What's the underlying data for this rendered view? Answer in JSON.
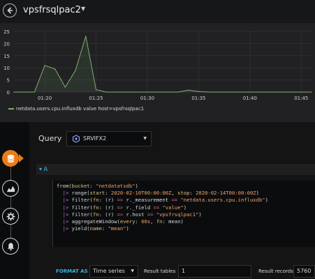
{
  "header": {
    "title": "vpsfrsqlpac2"
  },
  "graph": {
    "legend": "netdata.users.cpu.influxdb value host=vpsfrsqlpac1",
    "line_color": "#7eb26d"
  },
  "chart_data": {
    "type": "area",
    "title": "",
    "xlabel": "",
    "ylabel": "",
    "ylim": [
      0,
      25
    ],
    "y_ticks": [
      "0",
      "5",
      "10",
      "15",
      "20",
      "25"
    ],
    "x_ticks": [
      "01:20",
      "01:25",
      "01:30",
      "01:35",
      "01:40",
      "01:45"
    ],
    "series": [
      {
        "name": "netdata.users.cpu.influxdb value host=vpsfrsqlpac1",
        "x": [
          "01:17",
          "01:19",
          "01:20",
          "01:21",
          "01:22",
          "01:23",
          "01:24",
          "01:25",
          "01:26",
          "01:27",
          "01:28",
          "01:29",
          "01:30",
          "01:31",
          "01:32",
          "01:33",
          "01:34",
          "01:35",
          "01:36",
          "01:37",
          "01:38",
          "01:39",
          "01:40",
          "01:41",
          "01:42",
          "01:43",
          "01:44",
          "01:45",
          "01:46"
        ],
        "values": [
          0,
          0,
          11,
          9.5,
          2,
          9,
          23,
          1,
          0,
          0,
          0,
          0,
          0,
          0,
          0,
          0,
          0.8,
          0.2,
          0,
          0,
          0,
          0,
          0,
          0,
          0,
          0,
          0,
          0,
          0
        ]
      }
    ],
    "grid": true
  },
  "rail": {
    "active_index": 0
  },
  "query": {
    "label": "Query",
    "datasource": "SRVIFX2"
  },
  "query_row": {
    "label": "A"
  },
  "code": {
    "lines": [
      [
        [
          "c-fn",
          "from("
        ],
        [
          "c-param",
          "bucket"
        ],
        [
          "c-fn",
          ": "
        ],
        [
          "c-strv",
          "\"netdatatsdb\""
        ],
        [
          "c-fn",
          ")"
        ]
      ],
      [
        [
          "c-pipe",
          "  |>"
        ],
        [
          "c-fn",
          " range("
        ],
        [
          "c-param",
          "start"
        ],
        [
          "c-fn",
          ": "
        ],
        [
          "c-strv",
          "2020-02-10T00:00:00Z"
        ],
        [
          "c-fn",
          ", "
        ],
        [
          "c-param",
          "stop"
        ],
        [
          "c-fn",
          ": "
        ],
        [
          "c-strv",
          "2020-02-14T00:00:00Z"
        ],
        [
          "c-fn",
          ")"
        ]
      ],
      [
        [
          "c-pipe",
          "  |>"
        ],
        [
          "c-fn",
          " filter("
        ],
        [
          "c-param",
          "fn"
        ],
        [
          "c-fn",
          ": (r) "
        ],
        [
          "c-op",
          "=>"
        ],
        [
          "c-fn",
          " r._measurement "
        ],
        [
          "c-op",
          "=="
        ],
        [
          "c-fn",
          " "
        ],
        [
          "c-strv",
          "\"netdata.users.cpu.influxdb\""
        ],
        [
          "c-fn",
          ")"
        ]
      ],
      [
        [
          "c-pipe",
          "  |>"
        ],
        [
          "c-fn",
          " filter("
        ],
        [
          "c-param",
          "fn"
        ],
        [
          "c-fn",
          ": (r) "
        ],
        [
          "c-op",
          "=>"
        ],
        [
          "c-fn",
          " r._field "
        ],
        [
          "c-op",
          "=="
        ],
        [
          "c-fn",
          " "
        ],
        [
          "c-strv",
          "\"value\""
        ],
        [
          "c-fn",
          ")"
        ]
      ],
      [
        [
          "c-pipe",
          "  |>"
        ],
        [
          "c-fn",
          " filter("
        ],
        [
          "c-param",
          "fn"
        ],
        [
          "c-fn",
          ": (r) "
        ],
        [
          "c-op",
          "=>"
        ],
        [
          "c-fn",
          " r.host "
        ],
        [
          "c-op",
          "=="
        ],
        [
          "c-fn",
          " "
        ],
        [
          "c-strv",
          "\"vpsfrsqlpac1\""
        ],
        [
          "c-fn",
          ")"
        ]
      ],
      [
        [
          "c-pipe",
          "  |>"
        ],
        [
          "c-fn",
          " aggregateWindow("
        ],
        [
          "c-param",
          "every"
        ],
        [
          "c-fn",
          ": "
        ],
        [
          "c-strv",
          "60s"
        ],
        [
          "c-fn",
          ", "
        ],
        [
          "c-param",
          "fn"
        ],
        [
          "c-fn",
          ": mean)"
        ]
      ],
      [
        [
          "c-pipe",
          "  |>"
        ],
        [
          "c-fn",
          " yield("
        ],
        [
          "c-param",
          "name"
        ],
        [
          "c-fn",
          ": "
        ],
        [
          "c-strv",
          "\"mean\""
        ],
        [
          "c-fn",
          ")"
        ]
      ]
    ]
  },
  "format_bar": {
    "format_label": "FORMAT AS",
    "format_value": "Time series",
    "result_tables_label": "Result tables",
    "result_tables_value": "1",
    "result_records_label": "Result records",
    "result_records_value": "5760"
  }
}
